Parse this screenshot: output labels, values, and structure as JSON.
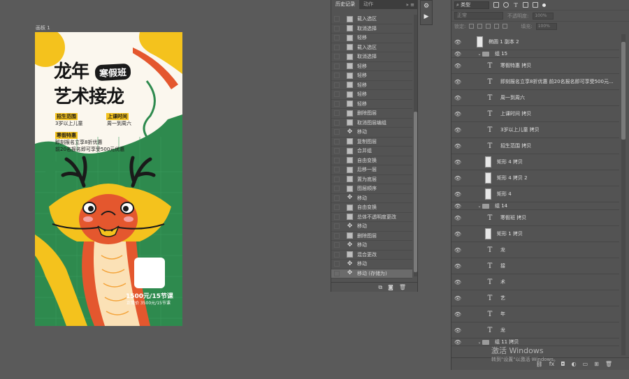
{
  "artboard": {
    "label": "画板 1",
    "title_line1": "龙年",
    "title_badge": "寒假班",
    "title_line2": "艺术接龙",
    "enroll_tag": "招生范围",
    "enroll_value": "3岁以上儿童",
    "time_tag": "上课时间",
    "time_value": "周一到周六",
    "promo_tag": "寒假特惠",
    "promo_line1": "即刻报名立享8折优惠",
    "promo_line2": "前20名报名即可享受500元优惠",
    "price": "1500元/15节课",
    "orig_price": "正常价 3500元/15节课",
    "colors": {
      "green": "#2e8a4e",
      "yellow": "#f4c21d",
      "red": "#e4572e",
      "cream": "#fbf7ee"
    }
  },
  "history": {
    "tab_active": "历史记录",
    "tab_other": "动作",
    "items": [
      {
        "label": "载入选区",
        "icon": "doc-icon"
      },
      {
        "label": "取消选择",
        "icon": "doc-icon"
      },
      {
        "label": "轻移",
        "icon": "doc-icon"
      },
      {
        "label": "载入选区",
        "icon": "doc-icon"
      },
      {
        "label": "取消选择",
        "icon": "doc-icon"
      },
      {
        "label": "轻移",
        "icon": "doc-icon"
      },
      {
        "label": "轻移",
        "icon": "doc-icon"
      },
      {
        "label": "轻移",
        "icon": "doc-icon"
      },
      {
        "label": "轻移",
        "icon": "doc-icon"
      },
      {
        "label": "轻移",
        "icon": "doc-icon"
      },
      {
        "label": "删除图层",
        "icon": "doc-icon"
      },
      {
        "label": "取消图层编组",
        "icon": "doc-icon"
      },
      {
        "label": "移动",
        "icon": "move-icon"
      },
      {
        "label": "复制图层",
        "icon": "doc-icon"
      },
      {
        "label": "合并组",
        "icon": "doc-icon"
      },
      {
        "label": "自由变换",
        "icon": "doc-icon"
      },
      {
        "label": "后移一层",
        "icon": "doc-icon"
      },
      {
        "label": "置为底层",
        "icon": "doc-icon"
      },
      {
        "label": "图层顺序",
        "icon": "doc-icon"
      },
      {
        "label": "移动",
        "icon": "move-icon"
      },
      {
        "label": "自由变换",
        "icon": "doc-icon"
      },
      {
        "label": "总体不透明度更改",
        "icon": "doc-icon"
      },
      {
        "label": "移动",
        "icon": "move-icon"
      },
      {
        "label": "删除图层",
        "icon": "doc-icon"
      },
      {
        "label": "移动",
        "icon": "move-icon"
      },
      {
        "label": "混合更改",
        "icon": "doc-icon"
      },
      {
        "label": "移动",
        "icon": "move-icon"
      },
      {
        "label": "移动 (存储为)",
        "icon": "move-icon"
      }
    ]
  },
  "layers": {
    "filter_label": "类型",
    "blend_mode": "正常",
    "opacity_label": "不透明度:",
    "opacity_value": "100%",
    "lock_label": "锁定:",
    "fill_label": "填充:",
    "fill_value": "100%",
    "items": [
      {
        "type": "shape",
        "name": "椭圆 1 副本 2"
      },
      {
        "type": "group",
        "name": "组 15"
      },
      {
        "type": "text",
        "name": "寒假特惠 拷贝"
      },
      {
        "type": "text",
        "name": "即刻报名立享8折优惠  前20名报名即可享受500元..."
      },
      {
        "type": "text",
        "name": "周一到周六"
      },
      {
        "type": "text",
        "name": "上课时间 拷贝"
      },
      {
        "type": "text",
        "name": "3岁以上儿童 拷贝"
      },
      {
        "type": "text",
        "name": "招生范围 拷贝"
      },
      {
        "type": "shape",
        "name": "矩形 4 拷贝"
      },
      {
        "type": "shape",
        "name": "矩形 4 拷贝 2"
      },
      {
        "type": "shape",
        "name": "矩形 4"
      },
      {
        "type": "group",
        "name": "组 14"
      },
      {
        "type": "text",
        "name": "寒假班 拷贝"
      },
      {
        "type": "shape",
        "name": "矩形 1 拷贝"
      },
      {
        "type": "text",
        "name": "龙"
      },
      {
        "type": "text",
        "name": "接"
      },
      {
        "type": "text",
        "name": "术"
      },
      {
        "type": "text",
        "name": "艺"
      },
      {
        "type": "text",
        "name": "年"
      },
      {
        "type": "text",
        "name": "龙"
      },
      {
        "type": "group",
        "name": "组 11 拷贝"
      }
    ]
  },
  "watermark": {
    "title": "激活 Windows",
    "subtitle": "转到\"设置\"以激活 Windows。"
  }
}
